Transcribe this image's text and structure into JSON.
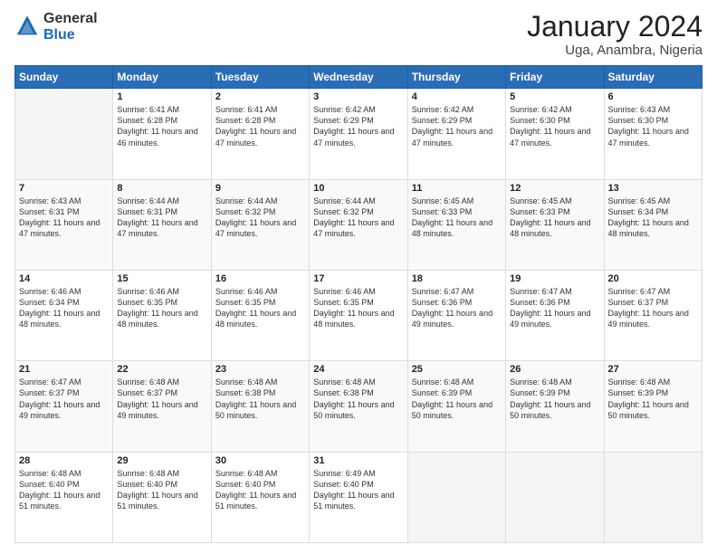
{
  "header": {
    "logo_general": "General",
    "logo_blue": "Blue",
    "main_title": "January 2024",
    "sub_title": "Uga, Anambra, Nigeria"
  },
  "calendar": {
    "days_header": [
      "Sunday",
      "Monday",
      "Tuesday",
      "Wednesday",
      "Thursday",
      "Friday",
      "Saturday"
    ],
    "weeks": [
      [
        {
          "day": "",
          "sunrise": "",
          "sunset": "",
          "daylight": ""
        },
        {
          "day": "1",
          "sunrise": "Sunrise: 6:41 AM",
          "sunset": "Sunset: 6:28 PM",
          "daylight": "Daylight: 11 hours and 46 minutes."
        },
        {
          "day": "2",
          "sunrise": "Sunrise: 6:41 AM",
          "sunset": "Sunset: 6:28 PM",
          "daylight": "Daylight: 11 hours and 47 minutes."
        },
        {
          "day": "3",
          "sunrise": "Sunrise: 6:42 AM",
          "sunset": "Sunset: 6:29 PM",
          "daylight": "Daylight: 11 hours and 47 minutes."
        },
        {
          "day": "4",
          "sunrise": "Sunrise: 6:42 AM",
          "sunset": "Sunset: 6:29 PM",
          "daylight": "Daylight: 11 hours and 47 minutes."
        },
        {
          "day": "5",
          "sunrise": "Sunrise: 6:42 AM",
          "sunset": "Sunset: 6:30 PM",
          "daylight": "Daylight: 11 hours and 47 minutes."
        },
        {
          "day": "6",
          "sunrise": "Sunrise: 6:43 AM",
          "sunset": "Sunset: 6:30 PM",
          "daylight": "Daylight: 11 hours and 47 minutes."
        }
      ],
      [
        {
          "day": "7",
          "sunrise": "Sunrise: 6:43 AM",
          "sunset": "Sunset: 6:31 PM",
          "daylight": "Daylight: 11 hours and 47 minutes."
        },
        {
          "day": "8",
          "sunrise": "Sunrise: 6:44 AM",
          "sunset": "Sunset: 6:31 PM",
          "daylight": "Daylight: 11 hours and 47 minutes."
        },
        {
          "day": "9",
          "sunrise": "Sunrise: 6:44 AM",
          "sunset": "Sunset: 6:32 PM",
          "daylight": "Daylight: 11 hours and 47 minutes."
        },
        {
          "day": "10",
          "sunrise": "Sunrise: 6:44 AM",
          "sunset": "Sunset: 6:32 PM",
          "daylight": "Daylight: 11 hours and 47 minutes."
        },
        {
          "day": "11",
          "sunrise": "Sunrise: 6:45 AM",
          "sunset": "Sunset: 6:33 PM",
          "daylight": "Daylight: 11 hours and 48 minutes."
        },
        {
          "day": "12",
          "sunrise": "Sunrise: 6:45 AM",
          "sunset": "Sunset: 6:33 PM",
          "daylight": "Daylight: 11 hours and 48 minutes."
        },
        {
          "day": "13",
          "sunrise": "Sunrise: 6:45 AM",
          "sunset": "Sunset: 6:34 PM",
          "daylight": "Daylight: 11 hours and 48 minutes."
        }
      ],
      [
        {
          "day": "14",
          "sunrise": "Sunrise: 6:46 AM",
          "sunset": "Sunset: 6:34 PM",
          "daylight": "Daylight: 11 hours and 48 minutes."
        },
        {
          "day": "15",
          "sunrise": "Sunrise: 6:46 AM",
          "sunset": "Sunset: 6:35 PM",
          "daylight": "Daylight: 11 hours and 48 minutes."
        },
        {
          "day": "16",
          "sunrise": "Sunrise: 6:46 AM",
          "sunset": "Sunset: 6:35 PM",
          "daylight": "Daylight: 11 hours and 48 minutes."
        },
        {
          "day": "17",
          "sunrise": "Sunrise: 6:46 AM",
          "sunset": "Sunset: 6:35 PM",
          "daylight": "Daylight: 11 hours and 48 minutes."
        },
        {
          "day": "18",
          "sunrise": "Sunrise: 6:47 AM",
          "sunset": "Sunset: 6:36 PM",
          "daylight": "Daylight: 11 hours and 49 minutes."
        },
        {
          "day": "19",
          "sunrise": "Sunrise: 6:47 AM",
          "sunset": "Sunset: 6:36 PM",
          "daylight": "Daylight: 11 hours and 49 minutes."
        },
        {
          "day": "20",
          "sunrise": "Sunrise: 6:47 AM",
          "sunset": "Sunset: 6:37 PM",
          "daylight": "Daylight: 11 hours and 49 minutes."
        }
      ],
      [
        {
          "day": "21",
          "sunrise": "Sunrise: 6:47 AM",
          "sunset": "Sunset: 6:37 PM",
          "daylight": "Daylight: 11 hours and 49 minutes."
        },
        {
          "day": "22",
          "sunrise": "Sunrise: 6:48 AM",
          "sunset": "Sunset: 6:37 PM",
          "daylight": "Daylight: 11 hours and 49 minutes."
        },
        {
          "day": "23",
          "sunrise": "Sunrise: 6:48 AM",
          "sunset": "Sunset: 6:38 PM",
          "daylight": "Daylight: 11 hours and 50 minutes."
        },
        {
          "day": "24",
          "sunrise": "Sunrise: 6:48 AM",
          "sunset": "Sunset: 6:38 PM",
          "daylight": "Daylight: 11 hours and 50 minutes."
        },
        {
          "day": "25",
          "sunrise": "Sunrise: 6:48 AM",
          "sunset": "Sunset: 6:39 PM",
          "daylight": "Daylight: 11 hours and 50 minutes."
        },
        {
          "day": "26",
          "sunrise": "Sunrise: 6:48 AM",
          "sunset": "Sunset: 6:39 PM",
          "daylight": "Daylight: 11 hours and 50 minutes."
        },
        {
          "day": "27",
          "sunrise": "Sunrise: 6:48 AM",
          "sunset": "Sunset: 6:39 PM",
          "daylight": "Daylight: 11 hours and 50 minutes."
        }
      ],
      [
        {
          "day": "28",
          "sunrise": "Sunrise: 6:48 AM",
          "sunset": "Sunset: 6:40 PM",
          "daylight": "Daylight: 11 hours and 51 minutes."
        },
        {
          "day": "29",
          "sunrise": "Sunrise: 6:48 AM",
          "sunset": "Sunset: 6:40 PM",
          "daylight": "Daylight: 11 hours and 51 minutes."
        },
        {
          "day": "30",
          "sunrise": "Sunrise: 6:48 AM",
          "sunset": "Sunset: 6:40 PM",
          "daylight": "Daylight: 11 hours and 51 minutes."
        },
        {
          "day": "31",
          "sunrise": "Sunrise: 6:49 AM",
          "sunset": "Sunset: 6:40 PM",
          "daylight": "Daylight: 11 hours and 51 minutes."
        },
        {
          "day": "",
          "sunrise": "",
          "sunset": "",
          "daylight": ""
        },
        {
          "day": "",
          "sunrise": "",
          "sunset": "",
          "daylight": ""
        },
        {
          "day": "",
          "sunrise": "",
          "sunset": "",
          "daylight": ""
        }
      ]
    ]
  }
}
